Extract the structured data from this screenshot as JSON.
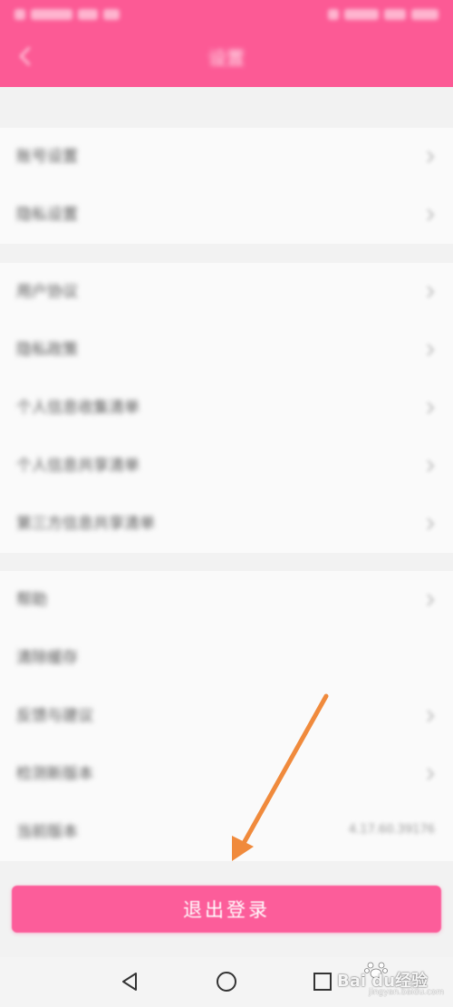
{
  "header": {
    "title": "设置",
    "color": "#fc5a95"
  },
  "groups": [
    {
      "items": [
        {
          "label": "账号设置"
        },
        {
          "label": "隐私设置"
        }
      ]
    },
    {
      "items": [
        {
          "label": "用户协议"
        },
        {
          "label": "隐私政策"
        },
        {
          "label": "个人信息收集清单"
        },
        {
          "label": "个人信息共享清单"
        },
        {
          "label": "第三方信息共享清单"
        }
      ]
    },
    {
      "items": [
        {
          "label": "帮助"
        },
        {
          "label": "清除缓存"
        },
        {
          "label": "反馈与建议"
        },
        {
          "label": "检测新版本"
        },
        {
          "label": "当前版本",
          "value": "4.17.60.39176"
        }
      ]
    }
  ],
  "logout": {
    "label": "退出登录",
    "color": "#fc5d9a"
  },
  "watermark": {
    "logo_text": "Bai du经验",
    "url": "jingyan.baidu.com"
  },
  "annotation": {
    "arrow_color": "#f08a3c"
  }
}
